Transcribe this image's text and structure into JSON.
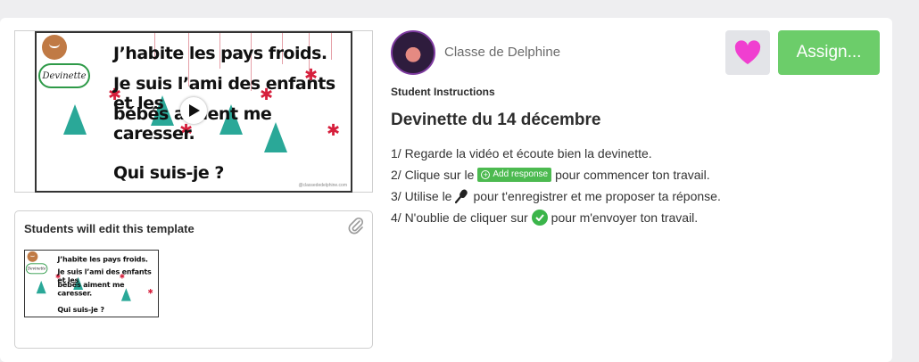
{
  "video": {
    "riddle_lines": [
      "J’habite les pays froids.",
      "Je suis l’ami des enfants et les",
      "bébés aiment me caresser.",
      "Qui suis-je ?"
    ],
    "badge": "Devinette",
    "watermark": "@classededelphine.com",
    "play_icon": "play-icon"
  },
  "template": {
    "title": "Students will edit this template",
    "attachment_icon": "paperclip-icon"
  },
  "author": {
    "name": "Classe de Delphine"
  },
  "actions": {
    "like_icon": "heart-icon",
    "like_color": "#f03fd0",
    "assign_label": "Assign..."
  },
  "instructions": {
    "label": "Student Instructions",
    "title": "Devinette du 14 décembre",
    "step1": "1/ Regarde la vidéo et écoute bien la devinette.",
    "step2_before": "2/ Clique sur le",
    "add_response_label": "Add response",
    "step2_after": "pour commencer ton travail.",
    "step3_before": "3/ Utilise le",
    "step3_after": "pour t'enregistrer et me proposer ta réponse.",
    "step4_before": "4/ N'oublie de cliquer sur",
    "step4_after": "pour m'envoyer ton travail."
  },
  "colors": {
    "accent_green": "#6ccd6a",
    "tree": "#2aa898",
    "star": "#d61f3c"
  }
}
